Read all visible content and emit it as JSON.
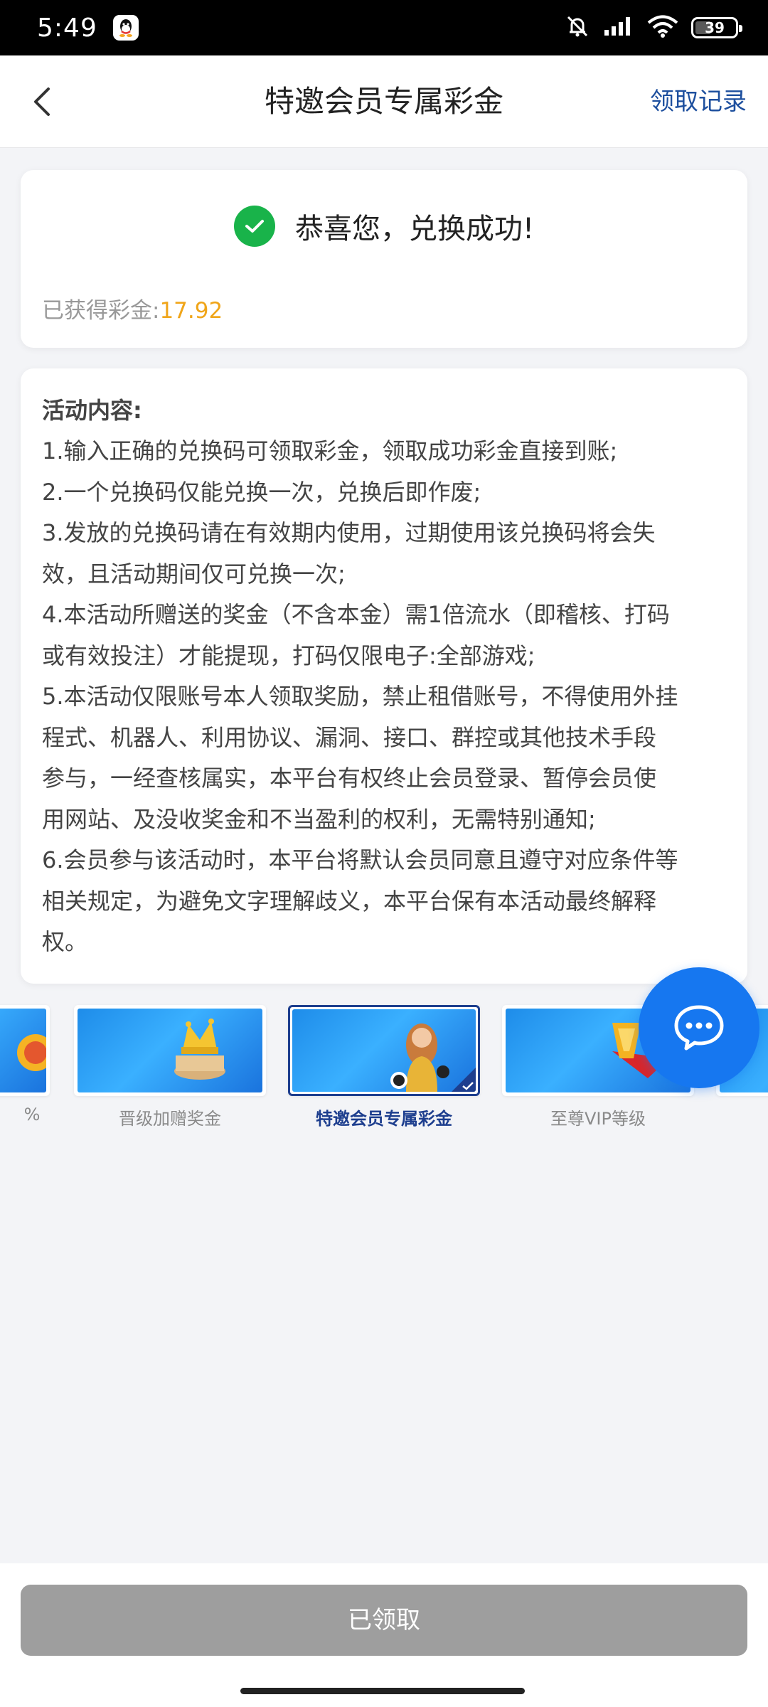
{
  "status_bar": {
    "time": "5:49",
    "battery": "39"
  },
  "header": {
    "title": "特邀会员专属彩金",
    "right_link": "领取记录"
  },
  "success": {
    "message": "恭喜您，兑换成功!",
    "earned_label": "已获得彩金:",
    "earned_value": "17.92"
  },
  "rules": {
    "title": "活动内容:",
    "lines": [
      "1.输入正确的兑换码可领取彩金，领取成功彩金直接到账;",
      "2.一个兑换码仅能兑换一次，兑换后即作废;",
      "3.发放的兑换码请在有效期内使用，过期使用该兑换码将会失",
      "效，且活动期间仅可兑换一次;",
      "4.本活动所赠送的奖金（不含本金）需1倍流水（即稽核、打码",
      "或有效投注）才能提现，打码仅限电子:全部游戏;",
      "5.本活动仅限账号本人领取奖励，禁止租借账号，不得使用外挂",
      "程式、机器人、利用协议、漏洞、接口、群控或其他技术手段",
      "参与，一经查核属实，本平台有权终止会员登录、暂停会员使",
      "用网站、及没收奖金和不当盈利的权利，无需特别通知;",
      "6.会员参与该活动时，本平台将默认会员同意且遵守对应条件等",
      "相关规定，为避免文字理解歧义，本平台保有本活动最终解释",
      "权。"
    ]
  },
  "carousel": {
    "items": [
      {
        "label": "%",
        "active": false
      },
      {
        "label": "晋级加赠奖金",
        "active": false
      },
      {
        "label": "特邀会员专属彩金",
        "active": true
      },
      {
        "label": "至尊VIP等级",
        "active": false
      }
    ]
  },
  "bottom": {
    "button_label": "已领取"
  },
  "colors": {
    "primary": "#1d3e8e",
    "accent": "#f0a519",
    "success": "#19b34a",
    "fab": "#1677f0"
  }
}
